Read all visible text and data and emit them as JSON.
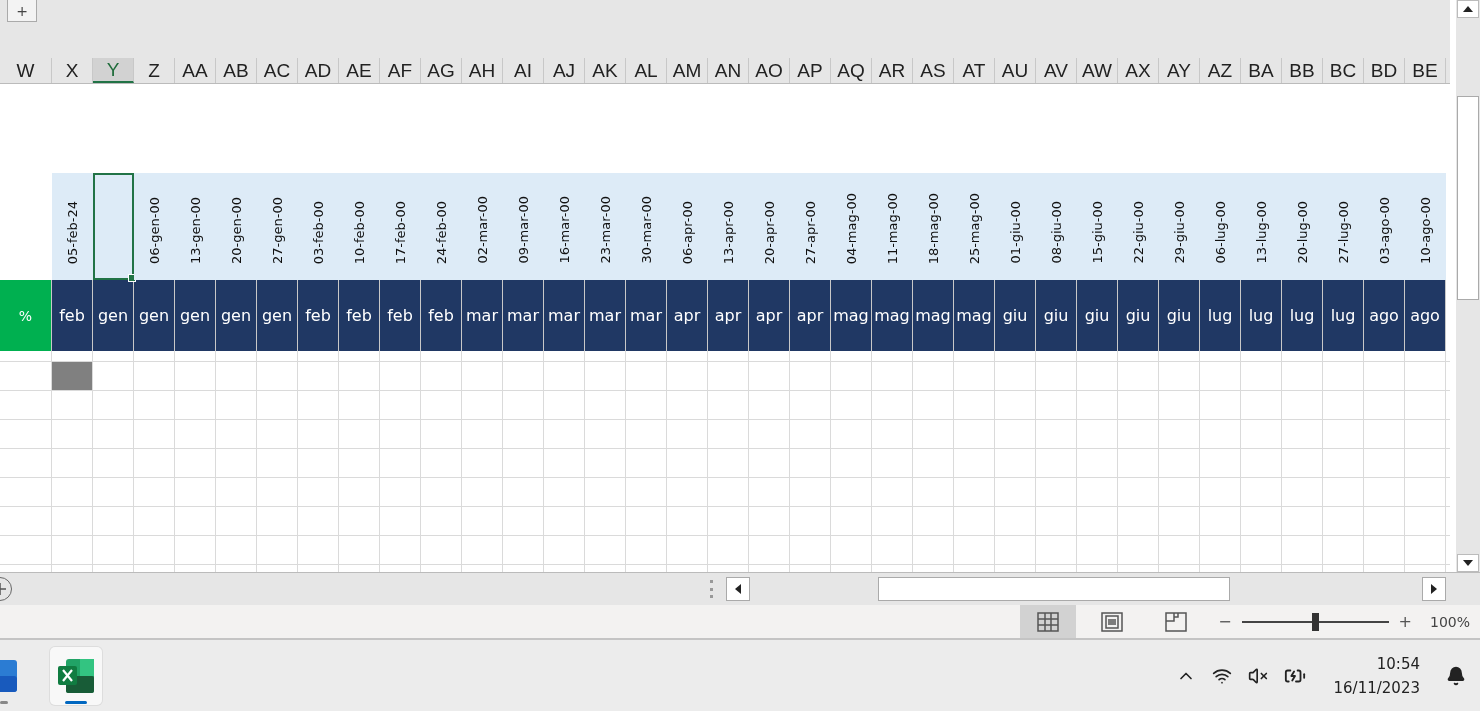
{
  "toolbar": {
    "add_button": "+"
  },
  "columns": [
    {
      "letter": "W",
      "selected": false,
      "kind": "label",
      "month": "%"
    },
    {
      "letter": "X",
      "selected": false,
      "kind": "week",
      "date": "05-feb-24",
      "month": "feb",
      "filled": true
    },
    {
      "letter": "Y",
      "selected": true,
      "kind": "week",
      "month": "gen"
    },
    {
      "letter": "Z",
      "selected": false,
      "kind": "week",
      "date": "06-gen-00",
      "month": "gen"
    },
    {
      "letter": "AA",
      "selected": false,
      "kind": "week",
      "date": "13-gen-00",
      "month": "gen"
    },
    {
      "letter": "AB",
      "selected": false,
      "kind": "week",
      "date": "20-gen-00",
      "month": "gen"
    },
    {
      "letter": "AC",
      "selected": false,
      "kind": "week",
      "date": "27-gen-00",
      "month": "gen"
    },
    {
      "letter": "AD",
      "selected": false,
      "kind": "week",
      "date": "03-feb-00",
      "month": "feb"
    },
    {
      "letter": "AE",
      "selected": false,
      "kind": "week",
      "date": "10-feb-00",
      "month": "feb"
    },
    {
      "letter": "AF",
      "selected": false,
      "kind": "week",
      "date": "17-feb-00",
      "month": "feb"
    },
    {
      "letter": "AG",
      "selected": false,
      "kind": "week",
      "date": "24-feb-00",
      "month": "feb"
    },
    {
      "letter": "AH",
      "selected": false,
      "kind": "week",
      "date": "02-mar-00",
      "month": "mar"
    },
    {
      "letter": "AI",
      "selected": false,
      "kind": "week",
      "date": "09-mar-00",
      "month": "mar"
    },
    {
      "letter": "AJ",
      "selected": false,
      "kind": "week",
      "date": "16-mar-00",
      "month": "mar"
    },
    {
      "letter": "AK",
      "selected": false,
      "kind": "week",
      "date": "23-mar-00",
      "month": "mar"
    },
    {
      "letter": "AL",
      "selected": false,
      "kind": "week",
      "date": "30-mar-00",
      "month": "mar"
    },
    {
      "letter": "AM",
      "selected": false,
      "kind": "week",
      "date": "06-apr-00",
      "month": "apr"
    },
    {
      "letter": "AN",
      "selected": false,
      "kind": "week",
      "date": "13-apr-00",
      "month": "apr"
    },
    {
      "letter": "AO",
      "selected": false,
      "kind": "week",
      "date": "20-apr-00",
      "month": "apr"
    },
    {
      "letter": "AP",
      "selected": false,
      "kind": "week",
      "date": "27-apr-00",
      "month": "apr"
    },
    {
      "letter": "AQ",
      "selected": false,
      "kind": "week",
      "date": "04-mag-00",
      "month": "mag"
    },
    {
      "letter": "AR",
      "selected": false,
      "kind": "week",
      "date": "11-mag-00",
      "month": "mag"
    },
    {
      "letter": "AS",
      "selected": false,
      "kind": "week",
      "date": "18-mag-00",
      "month": "mag"
    },
    {
      "letter": "AT",
      "selected": false,
      "kind": "week",
      "date": "25-mag-00",
      "month": "mag"
    },
    {
      "letter": "AU",
      "selected": false,
      "kind": "week",
      "date": "01-giu-00",
      "month": "giu"
    },
    {
      "letter": "AV",
      "selected": false,
      "kind": "week",
      "date": "08-giu-00",
      "month": "giu"
    },
    {
      "letter": "AW",
      "selected": false,
      "kind": "week",
      "date": "15-giu-00",
      "month": "giu"
    },
    {
      "letter": "AX",
      "selected": false,
      "kind": "week",
      "date": "22-giu-00",
      "month": "giu"
    },
    {
      "letter": "AY",
      "selected": false,
      "kind": "week",
      "date": "29-giu-00",
      "month": "giu"
    },
    {
      "letter": "AZ",
      "selected": false,
      "kind": "week",
      "date": "06-lug-00",
      "month": "lug"
    },
    {
      "letter": "BA",
      "selected": false,
      "kind": "week",
      "date": "13-lug-00",
      "month": "lug"
    },
    {
      "letter": "BB",
      "selected": false,
      "kind": "week",
      "date": "20-lug-00",
      "month": "lug"
    },
    {
      "letter": "BC",
      "selected": false,
      "kind": "week",
      "date": "27-lug-00",
      "month": "lug"
    },
    {
      "letter": "BD",
      "selected": false,
      "kind": "week",
      "date": "03-ago-00",
      "month": "ago"
    },
    {
      "letter": "BE",
      "selected": false,
      "kind": "week",
      "date": "10-ago-00",
      "month": "ago"
    }
  ],
  "status_bar": {
    "views": [
      {
        "kind": "normal",
        "selected": true
      },
      {
        "kind": "page_layout",
        "selected": false
      },
      {
        "kind": "page_break",
        "selected": false
      }
    ],
    "zoom": {
      "minus": "−",
      "plus": "+",
      "level": 0.5,
      "reading": "100%"
    }
  },
  "taskbar": {
    "apps": [
      {
        "kind": "word",
        "selected": false
      },
      {
        "kind": "excel",
        "selected": true
      }
    ],
    "clock": {
      "time": "10:54",
      "date": "16/11/2023"
    }
  }
}
